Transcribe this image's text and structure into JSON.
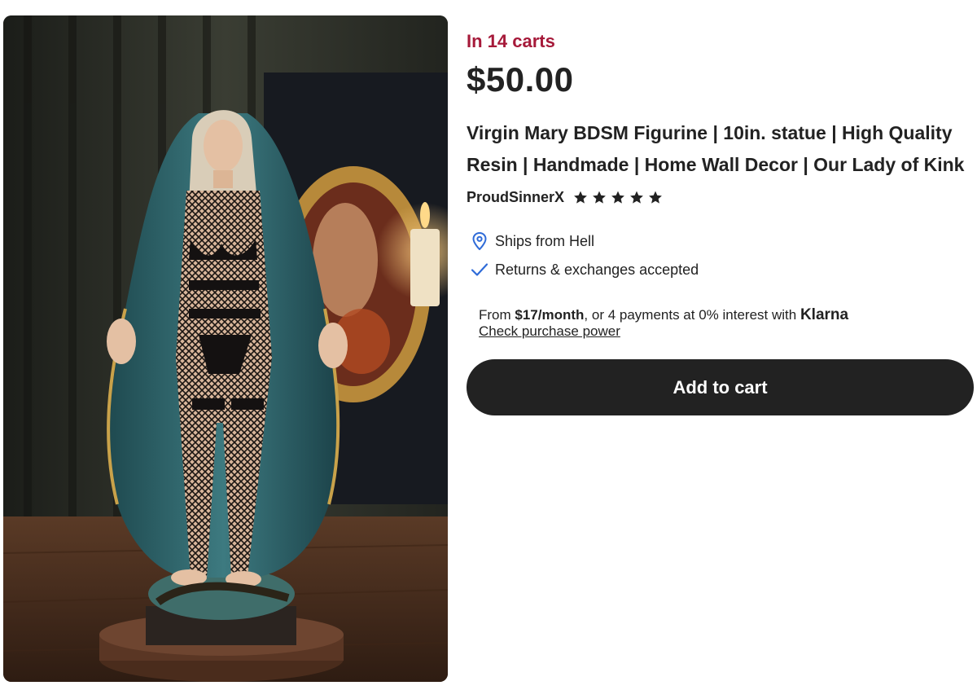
{
  "listing": {
    "demand_text": "In 14 carts",
    "price": "$50.00",
    "title_lines": [
      "Virgin Mary BDSM Figurine | 10in. statue | High Quality",
      "Resin | Handmade | Home Wall Decor | Our Lady of Kink"
    ],
    "shop_name": "ProudSinnerX",
    "rating_stars": 5,
    "demand_color": "#a61a3a"
  },
  "features": [
    {
      "icon": "map-pin-icon",
      "text": "Ships from Hell",
      "icon_color": "#2f6bd8"
    },
    {
      "icon": "checkmark-icon",
      "text": "Returns & exchanges accepted",
      "icon_color": "#2f6bd8"
    }
  ],
  "installment": {
    "prefix": "From ",
    "amount": "$17/month",
    "middle": ", or 4 payments at 0% interest with ",
    "provider": "Klarna",
    "link": "Check purchase power"
  },
  "cart": {
    "button_label": "Add to cart",
    "button_color": "#222222"
  },
  "image": {
    "subject": "product-photo-figurine"
  }
}
